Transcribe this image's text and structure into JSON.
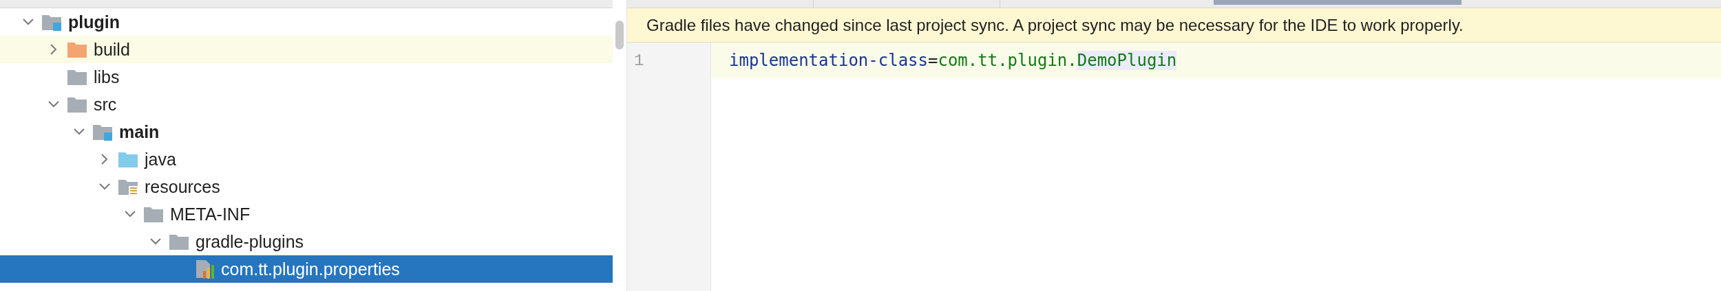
{
  "project_tree": {
    "nodes": [
      {
        "label": "plugin",
        "kind": "module",
        "expanded": true,
        "selected": false,
        "highlighted": false,
        "children": [
          {
            "label": "build",
            "kind": "excluded",
            "expanded": false,
            "selected": false,
            "highlighted": true
          },
          {
            "label": "libs",
            "kind": "folder",
            "selected": false,
            "highlighted": false
          },
          {
            "label": "src",
            "kind": "folder",
            "expanded": true,
            "selected": false,
            "highlighted": false,
            "children": [
              {
                "label": "main",
                "kind": "module",
                "expanded": true,
                "selected": false,
                "highlighted": false,
                "children": [
                  {
                    "label": "java",
                    "kind": "source",
                    "expanded": false,
                    "selected": false,
                    "highlighted": false
                  },
                  {
                    "label": "resources",
                    "kind": "resources",
                    "expanded": true,
                    "selected": false,
                    "highlighted": false,
                    "children": [
                      {
                        "label": "META-INF",
                        "kind": "folder",
                        "expanded": true,
                        "selected": false,
                        "highlighted": false,
                        "children": [
                          {
                            "label": "gradle-plugins",
                            "kind": "folder",
                            "expanded": true,
                            "selected": false,
                            "highlighted": false,
                            "children": [
                              {
                                "label": "com.tt.plugin.properties",
                                "kind": "properties",
                                "selected": true,
                                "highlighted": false
                              }
                            ]
                          }
                        ]
                      }
                    ]
                  }
                ]
              }
            ]
          }
        ]
      }
    ]
  },
  "editor": {
    "banner": "Gradle files have changed since last project sync. A project sync may be necessary for the IDE to work properly.",
    "lines": [
      {
        "number": "1",
        "current": true,
        "tokens": [
          {
            "text": "implementation-class",
            "kind": "key",
            "highlighted": false
          },
          {
            "text": "=",
            "kind": "operator",
            "highlighted": false
          },
          {
            "text": "com.tt.plugin.",
            "kind": "value",
            "highlighted": false
          },
          {
            "text": "DemoPlugin",
            "kind": "value",
            "highlighted": true
          }
        ]
      }
    ]
  }
}
